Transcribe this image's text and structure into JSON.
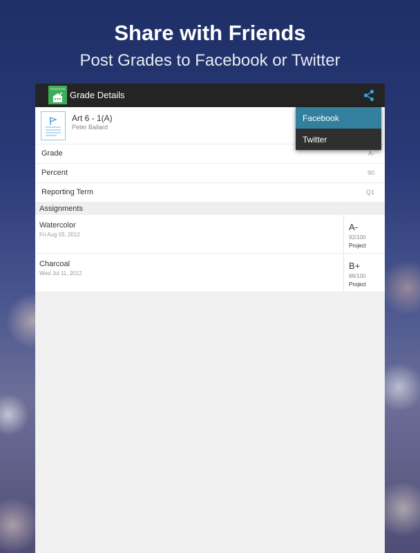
{
  "promo": {
    "headline": "Share with Friends",
    "subheadline": "Post Grades to Facebook or Twitter"
  },
  "actionbar": {
    "logo_text": "PEARSON",
    "title": "Grade Details",
    "share_icon": "share-icon"
  },
  "course": {
    "title": "Art 6 - 1(A)",
    "teacher": "Peter Ballard",
    "icon": "document-icon"
  },
  "details": [
    {
      "label": "Grade",
      "value": "A-"
    },
    {
      "label": "Percent",
      "value": "90"
    },
    {
      "label": "Reporting Term",
      "value": "Q1"
    }
  ],
  "assignments_header": "Assignments",
  "assignments": [
    {
      "name": "Watercolor",
      "date": "Fri Aug 03, 2012",
      "grade": "A-",
      "score": "92/100",
      "type": "Project"
    },
    {
      "name": "Charcoal",
      "date": "Wed Jul 11, 2012",
      "grade": "B+",
      "score": "88/100",
      "type": "Project"
    }
  ],
  "share_menu": {
    "items": [
      {
        "label": "Facebook",
        "selected": true
      },
      {
        "label": "Twitter",
        "selected": false
      }
    ]
  },
  "colors": {
    "actionbar": "#242424",
    "logo_green": "#3fae5a",
    "menu_selected": "#33809e",
    "share_accent": "#36a5e0"
  }
}
